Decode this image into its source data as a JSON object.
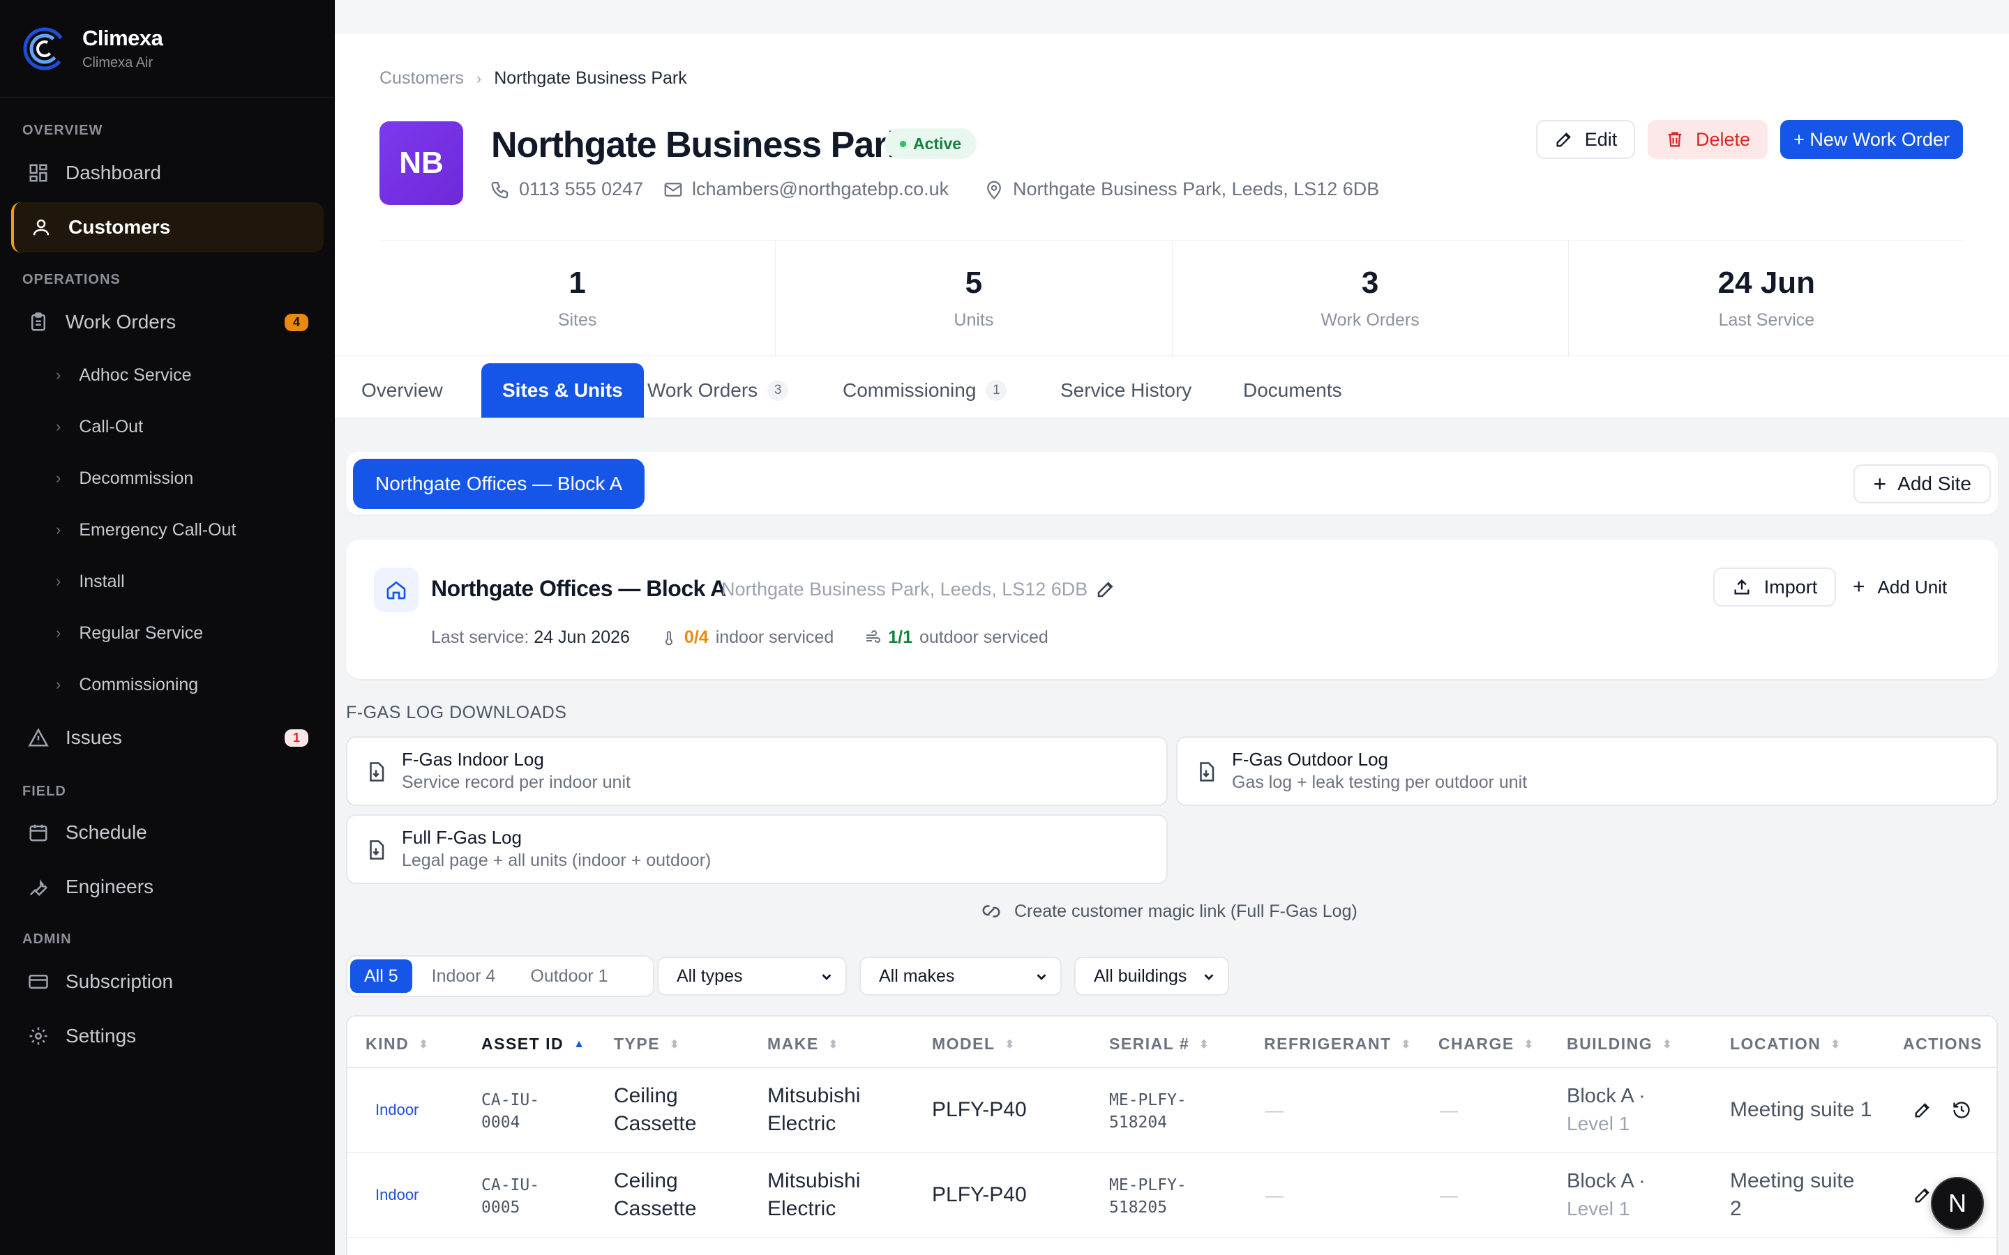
{
  "brand": {
    "name": "Climexa",
    "sub": "Climexa Air"
  },
  "sidebar": {
    "sections": {
      "overview": "OVERVIEW",
      "operations": "OPERATIONS",
      "field": "FIELD",
      "admin": "ADMIN"
    },
    "dashboard": "Dashboard",
    "customers": "Customers",
    "work_orders": {
      "label": "Work Orders",
      "count": "4"
    },
    "sub_items": [
      "Adhoc Service",
      "Call-Out",
      "Decommission",
      "Emergency Call-Out",
      "Install",
      "Regular Service",
      "Commissioning"
    ],
    "issues": {
      "label": "Issues",
      "count": "1"
    },
    "schedule": "Schedule",
    "engineers": "Engineers",
    "subscription": "Subscription",
    "settings": "Settings"
  },
  "breadcrumb": {
    "parent": "Customers",
    "current": "Northgate Business Park"
  },
  "customer": {
    "initials": "NB",
    "name": "Northgate Business Park",
    "status": "Active",
    "phone": "0113 555 0247",
    "email": "lchambers@northgatebp.co.uk",
    "address": "Northgate Business Park, Leeds, LS12 6DB"
  },
  "actions": {
    "edit": "Edit",
    "delete": "Delete",
    "new_work_order": "+ New Work Order"
  },
  "stats": [
    {
      "value": "1",
      "label": "Sites"
    },
    {
      "value": "5",
      "label": "Units"
    },
    {
      "value": "3",
      "label": "Work Orders"
    },
    {
      "value": "24 Jun",
      "label": "Last Service"
    }
  ],
  "tabs": {
    "overview": "Overview",
    "sites_units": "Sites & Units",
    "work_orders": {
      "label": "Work Orders",
      "count": "3"
    },
    "commissioning": {
      "label": "Commissioning",
      "count": "1"
    },
    "service_history": "Service History",
    "documents": "Documents"
  },
  "site_bar": {
    "selected_site": "Northgate Offices — Block A",
    "add_site": "Add Site"
  },
  "site": {
    "name": "Northgate Offices — Block A",
    "address": "Northgate Business Park, Leeds, LS12 6DB",
    "last_service_label": "Last service:",
    "last_service": "24 Jun 2026",
    "indoor_count": "0/4",
    "indoor_label": "indoor serviced",
    "outdoor_count": "1/1",
    "outdoor_label": "outdoor serviced",
    "import": "Import",
    "add_unit": "Add Unit"
  },
  "fgas": {
    "heading": "F-GAS LOG DOWNLOADS",
    "cards": [
      {
        "title": "F-Gas Indoor Log",
        "desc": "Service record per indoor unit"
      },
      {
        "title": "F-Gas Outdoor Log",
        "desc": "Gas log + leak testing per outdoor unit"
      },
      {
        "title": "Full F-Gas Log",
        "desc": "Legal page + all units (indoor + outdoor)"
      }
    ],
    "magic_link": "Create customer magic link (Full F-Gas Log)"
  },
  "filters": {
    "segments": [
      "All 5",
      "Indoor 4",
      "Outdoor 1"
    ],
    "types": "All types",
    "makes": "All makes",
    "buildings": "All buildings"
  },
  "table": {
    "columns": [
      "KIND",
      "ASSET ID",
      "TYPE",
      "MAKE",
      "MODEL",
      "SERIAL #",
      "REFRIGERANT",
      "CHARGE",
      "BUILDING",
      "LOCATION",
      "ACTIONS"
    ],
    "rows": [
      {
        "kind": "Indoor",
        "asset_id_1": "CA-IU-",
        "asset_id_2": "0004",
        "type_1": "Ceiling",
        "type_2": "Cassette",
        "make_1": "Mitsubishi",
        "make_2": "Electric",
        "model": "PLFY-P40",
        "serial_1": "ME-PLFY-",
        "serial_2": "518204",
        "refrigerant": "—",
        "charge": "—",
        "building_1": "Block A ·",
        "building_2": "Level 1",
        "location_1": "Meeting suite 1",
        "location_2": ""
      },
      {
        "kind": "Indoor",
        "asset_id_1": "CA-IU-",
        "asset_id_2": "0005",
        "type_1": "Ceiling",
        "type_2": "Cassette",
        "make_1": "Mitsubishi",
        "make_2": "Electric",
        "model": "PLFY-P40",
        "serial_1": "ME-PLFY-",
        "serial_2": "518205",
        "refrigerant": "—",
        "charge": "—",
        "building_1": "Block A ·",
        "building_2": "Level 1",
        "location_1": "Meeting suite",
        "location_2": "2"
      }
    ]
  },
  "floating_badge": "N"
}
